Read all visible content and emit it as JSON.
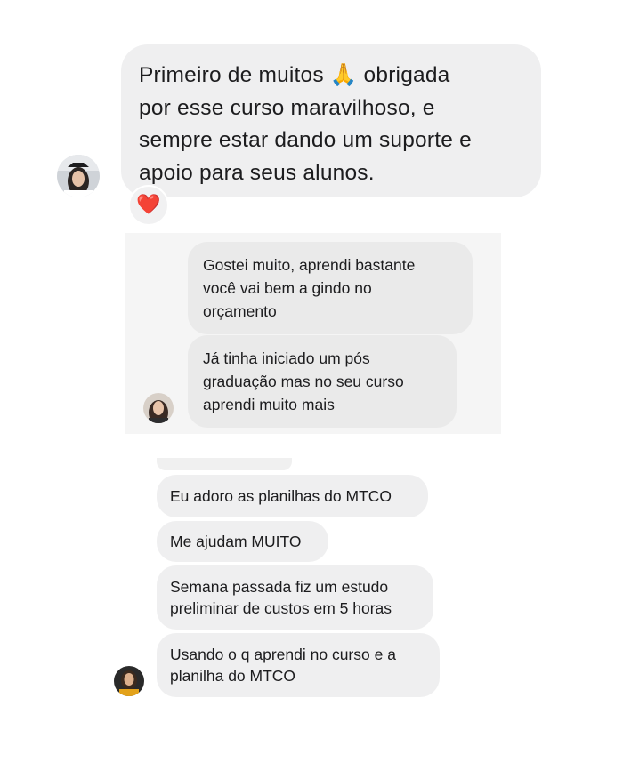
{
  "conversation_1": {
    "message": "Primeiro de muitos 🙏 obrigada\npor esse curso maravilhoso, e\nsempre estar dando um suporte e\napoio para seus alunos.",
    "reaction": "❤️"
  },
  "conversation_2": {
    "messages": [
      "Gostei muito, aprendi bastante\nvocê vai bem a gindo no\norçamento",
      "Já tinha iniciado um pós\ngraduação mas no seu curso\naprendi muito mais"
    ]
  },
  "conversation_3": {
    "messages": [
      "Eu adoro as planilhas do MTCO",
      "Me ajudam MUITO",
      "Semana passada fiz um estudo\npreliminar de custos em 5 horas",
      "Usando o q aprendi no curso e a\nplanilha do MTCO"
    ]
  }
}
